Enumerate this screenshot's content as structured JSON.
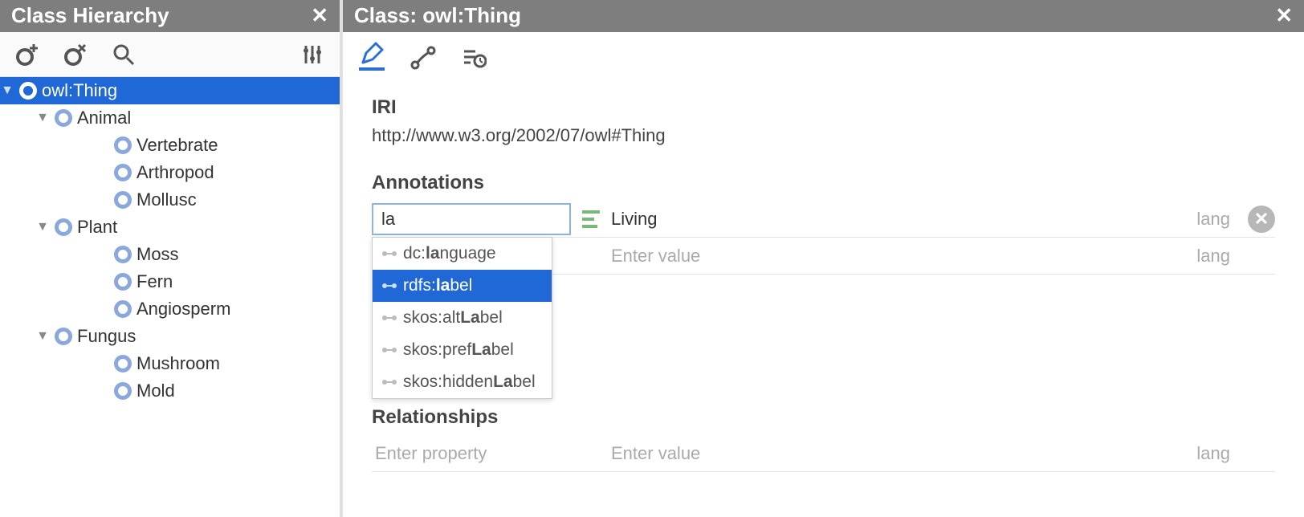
{
  "left": {
    "title": "Class Hierarchy",
    "tree": [
      {
        "label": "owl:Thing"
      },
      {
        "label": "Animal"
      },
      {
        "label": "Vertebrate"
      },
      {
        "label": "Arthropod"
      },
      {
        "label": "Mollusc"
      },
      {
        "label": "Plant"
      },
      {
        "label": "Moss"
      },
      {
        "label": "Fern"
      },
      {
        "label": "Angiosperm"
      },
      {
        "label": "Fungus"
      },
      {
        "label": "Mushroom"
      },
      {
        "label": "Mold"
      }
    ]
  },
  "right": {
    "title": "Class: owl:Thing",
    "iri_label": "IRI",
    "iri_value": "http://www.w3.org/2002/07/owl#Thing",
    "annotations_label": "Annotations",
    "relationships_label": "Relationships",
    "prop_input_value": "la",
    "value_living": "Living",
    "value_placeholder": "Enter value",
    "prop_placeholder": "Enter property",
    "lang_placeholder": "lang",
    "autocomplete": [
      {
        "prefix": "dc:",
        "bold": "la",
        "suffix": "nguage"
      },
      {
        "prefix": "rdfs:",
        "bold": "la",
        "suffix": "bel"
      },
      {
        "prefix": "skos:alt",
        "bold": "La",
        "suffix": "bel"
      },
      {
        "prefix": "skos:pref",
        "bold": "La",
        "suffix": "bel"
      },
      {
        "prefix": "skos:hidden",
        "bold": "La",
        "suffix": "bel"
      }
    ]
  }
}
